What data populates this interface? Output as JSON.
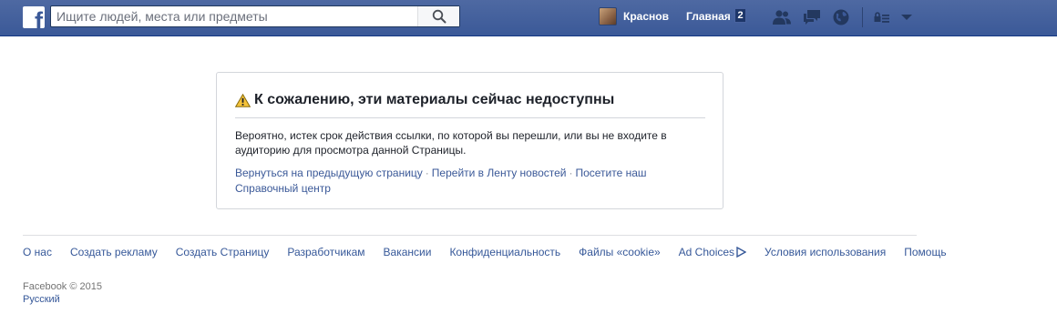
{
  "topbar": {
    "logo_letter": "f",
    "search": {
      "placeholder": "Ищите людей, места или предметы",
      "value": ""
    },
    "profile_name": "Краснов",
    "home_label": "Главная",
    "home_count": "2",
    "icons": [
      "friend-requests-icon",
      "messages-icon",
      "notifications-icon",
      "privacy-shortcuts-icon",
      "account-menu-arrow-icon"
    ],
    "bg_color": "#3b5998"
  },
  "error": {
    "title": "К сожалению, эти материалы сейчас недоступны",
    "message": "Вероятно, истек срок действия ссылки, по которой вы перешли, или вы не входите в аудиторию для просмотра данной Страницы.",
    "links": [
      {
        "label": "Вернуться на предыдущую страницу"
      },
      {
        "label": "Перейти в Ленту новостей"
      },
      {
        "label": "Посетите наш Справочный центр"
      }
    ],
    "separator": "·",
    "warning_color": "#f5c33b"
  },
  "footer": {
    "links": [
      {
        "label": "О нас"
      },
      {
        "label": "Создать рекламу"
      },
      {
        "label": "Создать Страницу"
      },
      {
        "label": "Разработчикам"
      },
      {
        "label": "Вакансии"
      },
      {
        "label": "Конфиденциальность"
      },
      {
        "label": "Файлы «cookie»"
      },
      {
        "label": "Ad Choices"
      },
      {
        "label": "Условия использования"
      },
      {
        "label": "Помощь"
      }
    ],
    "copyright": "Facebook © 2015",
    "language": "Русский",
    "link_color": "#365899"
  }
}
